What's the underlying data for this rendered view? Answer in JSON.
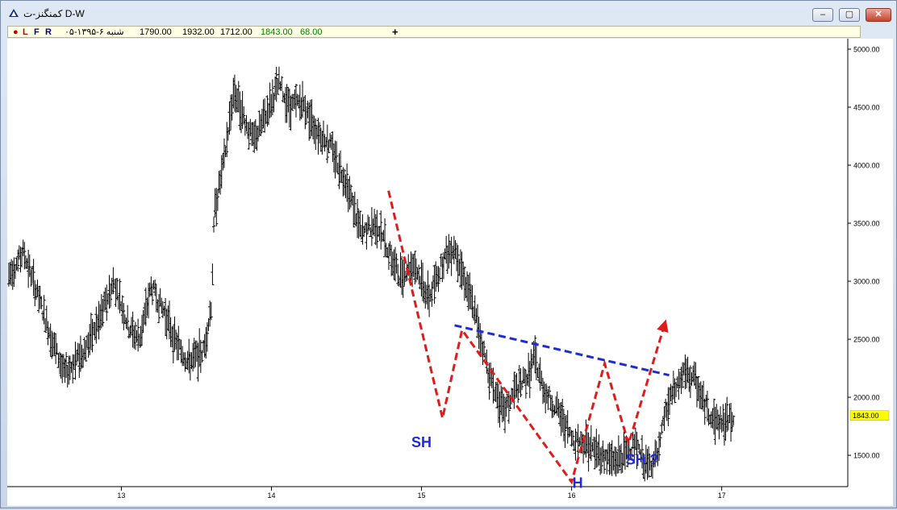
{
  "window": {
    "title": "کمنگنز-ت D-W",
    "controls": [
      "–",
      "▢",
      "✕"
    ]
  },
  "toolbar": {
    "markers": [
      "L",
      "F",
      "R"
    ],
    "marker_colors": [
      "#c00000",
      "#c00000",
      "#00008b",
      "#00008b"
    ],
    "date": "شنبه ۶-۱۳۹۵-۰۵",
    "open": "1790.00",
    "high": "1932.00",
    "low": "1712.00",
    "close": "1843.00",
    "change": "68.00",
    "add_label": "+"
  },
  "chart_data": {
    "type": "bar",
    "subtype": "ohlc",
    "title": "",
    "xlabel": "",
    "ylabel": "",
    "x_ticks": [
      "13",
      "14",
      "15",
      "16",
      "17"
    ],
    "y_ticks": [
      1500,
      2000,
      2500,
      3000,
      3500,
      4000,
      4500,
      5000
    ],
    "y_tick_labels": [
      "1500.00",
      "2000.00",
      "2500.00",
      "3000.00",
      "3500.00",
      "4000.00",
      "4500.00",
      "5000.00"
    ],
    "ylim": [
      1230,
      5090
    ],
    "xlim": [
      12.24,
      17.84
    ],
    "last_price_label": "1843.00",
    "last_price": 1843,
    "grid": false,
    "price_path": [
      [
        12.25,
        3050
      ],
      [
        12.35,
        3250
      ],
      [
        12.45,
        2850
      ],
      [
        12.55,
        2450
      ],
      [
        12.62,
        2200
      ],
      [
        12.75,
        2400
      ],
      [
        12.85,
        2650
      ],
      [
        12.95,
        3000
      ],
      [
        13.05,
        2600
      ],
      [
        13.12,
        2500
      ],
      [
        13.2,
        2950
      ],
      [
        13.3,
        2700
      ],
      [
        13.35,
        2500
      ],
      [
        13.45,
        2300
      ],
      [
        13.55,
        2400
      ],
      [
        13.6,
        2800
      ],
      [
        13.62,
        3600
      ],
      [
        13.68,
        4000
      ],
      [
        13.75,
        4650
      ],
      [
        13.82,
        4400
      ],
      [
        13.88,
        4200
      ],
      [
        13.95,
        4400
      ],
      [
        14.05,
        4700
      ],
      [
        14.12,
        4500
      ],
      [
        14.2,
        4550
      ],
      [
        14.3,
        4300
      ],
      [
        14.38,
        4200
      ],
      [
        14.5,
        3850
      ],
      [
        14.6,
        3400
      ],
      [
        14.7,
        3500
      ],
      [
        14.85,
        3050
      ],
      [
        14.95,
        3150
      ],
      [
        15.05,
        2850
      ],
      [
        15.15,
        3200
      ],
      [
        15.22,
        3300
      ],
      [
        15.35,
        2750
      ],
      [
        15.45,
        2200
      ],
      [
        15.55,
        1850
      ],
      [
        15.62,
        2050
      ],
      [
        15.72,
        2200
      ],
      [
        15.75,
        2350
      ],
      [
        15.82,
        2050
      ],
      [
        15.9,
        1900
      ],
      [
        16.0,
        1650
      ],
      [
        16.1,
        1600
      ],
      [
        16.2,
        1500
      ],
      [
        16.28,
        1450
      ],
      [
        16.35,
        1500
      ],
      [
        16.42,
        1600
      ],
      [
        16.5,
        1400
      ],
      [
        16.58,
        1500
      ],
      [
        16.62,
        1850
      ],
      [
        16.68,
        2050
      ],
      [
        16.75,
        2200
      ],
      [
        16.82,
        2150
      ],
      [
        16.88,
        1950
      ],
      [
        16.95,
        1800
      ],
      [
        17.02,
        1780
      ],
      [
        17.08,
        1843
      ]
    ],
    "annotations": {
      "labels": [
        "SH",
        "H",
        "SH ?"
      ],
      "label_color": "#1f2bd6",
      "pattern_color": "#e01b1b",
      "neckline_color": "#1f2bd6",
      "pattern_line": [
        [
          14.78,
          3780
        ],
        [
          15.14,
          1820
        ],
        [
          15.27,
          2580
        ],
        [
          16.0,
          1270
        ],
        [
          16.22,
          2290
        ],
        [
          16.38,
          1600
        ],
        [
          16.62,
          2630
        ]
      ],
      "neckline": [
        [
          15.22,
          2620
        ],
        [
          16.65,
          2190
        ]
      ]
    }
  }
}
